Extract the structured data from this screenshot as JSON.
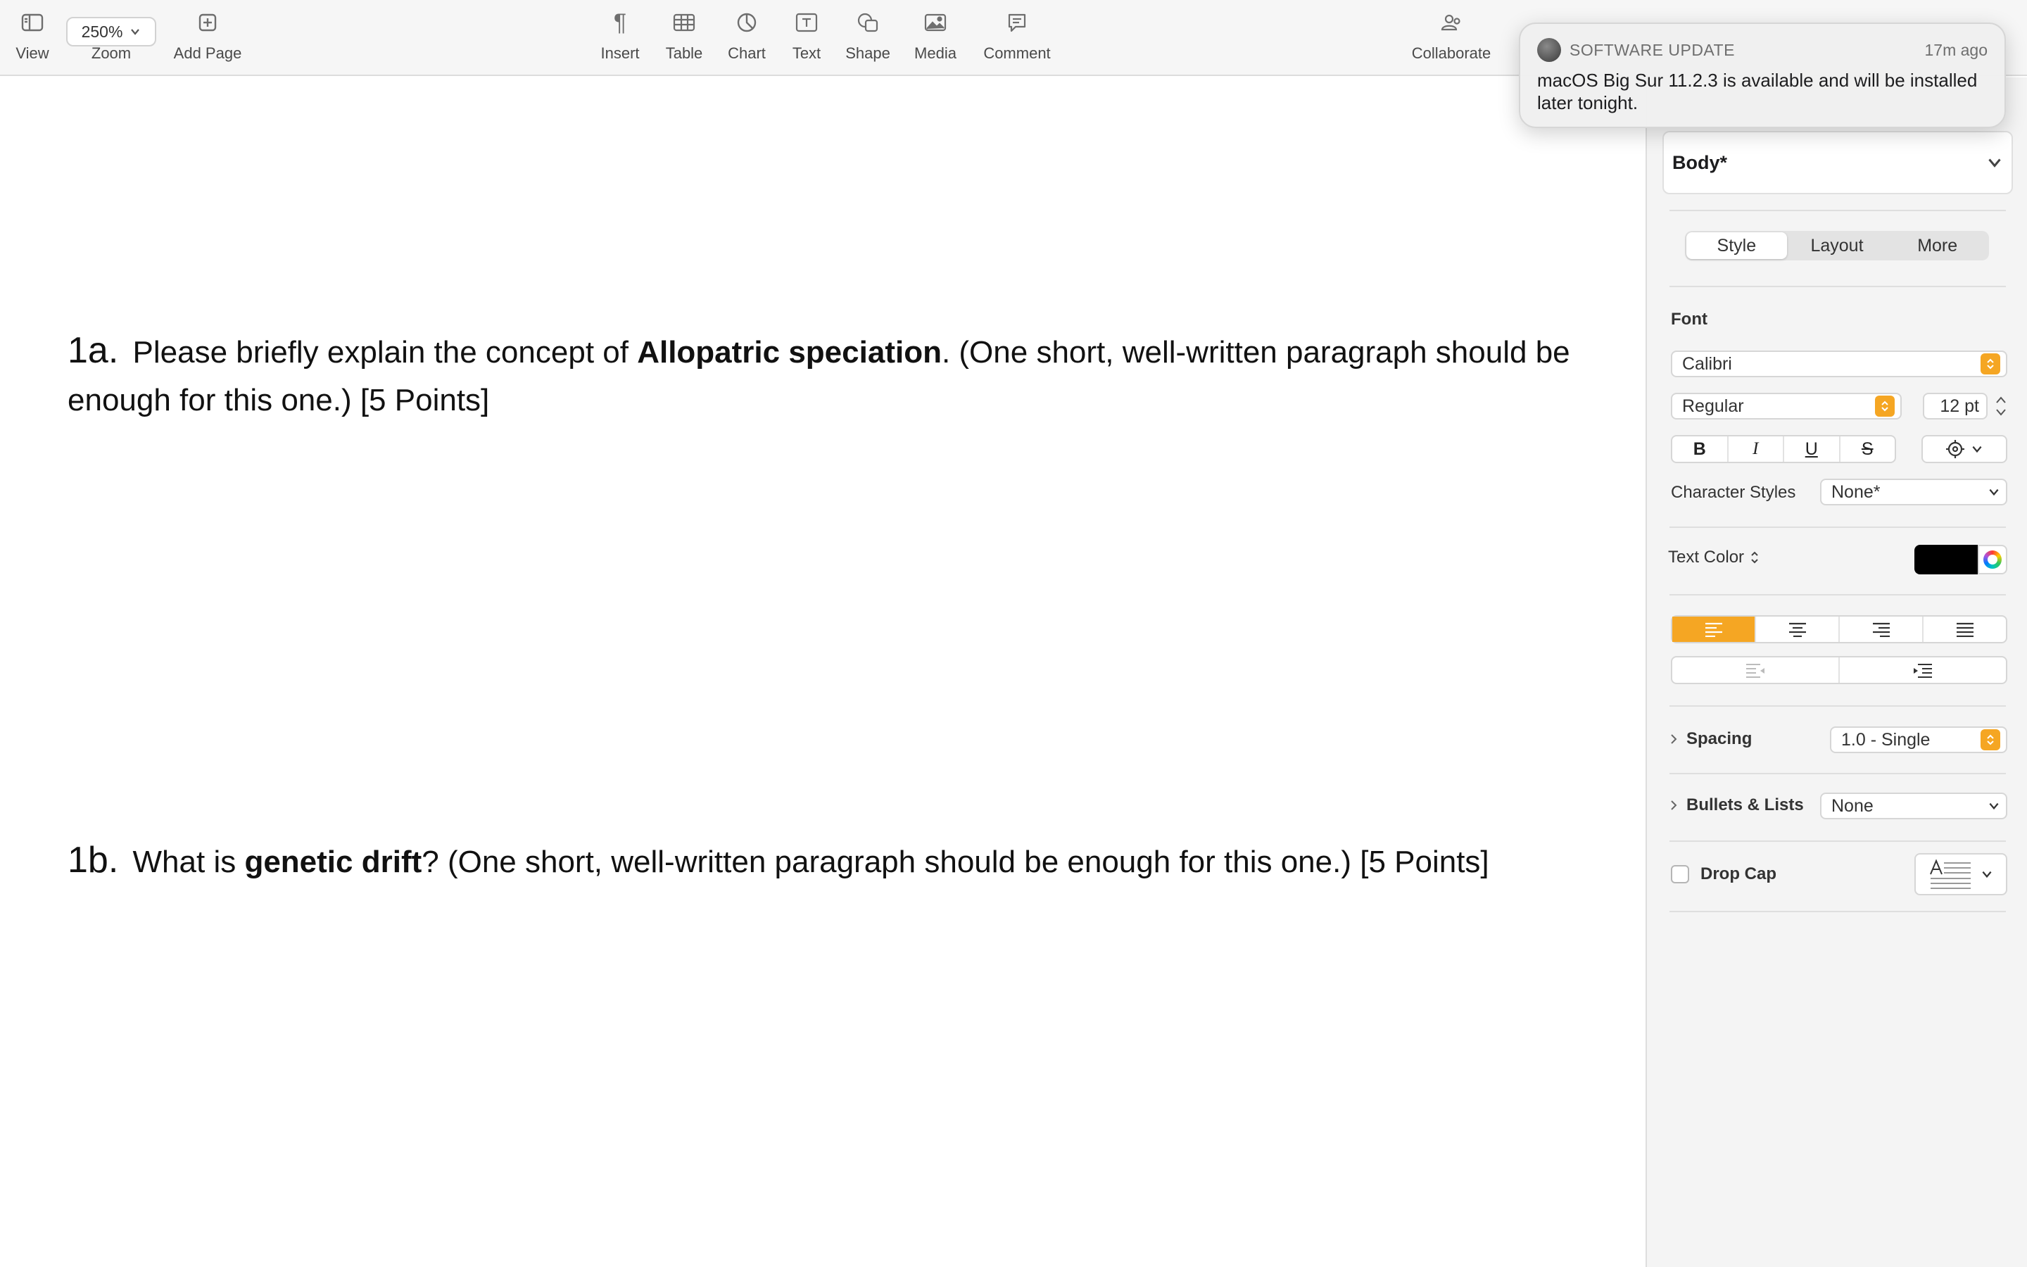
{
  "toolbar": {
    "view_label": "View",
    "zoom_value": "250%",
    "zoom_label": "Zoom",
    "add_page_label": "Add Page",
    "insert_label": "Insert",
    "table_label": "Table",
    "chart_label": "Chart",
    "text_label": "Text",
    "shape_label": "Shape",
    "media_label": "Media",
    "comment_label": "Comment",
    "collaborate_label": "Collaborate"
  },
  "notification": {
    "app": "SOFTWARE UPDATE",
    "time": "17m ago",
    "body": "macOS Big Sur 11.2.3 is available and will be installed later tonight."
  },
  "document": {
    "q1a": {
      "num": "1a.",
      "pre": "Please briefly explain the concept of ",
      "bold": "Allopatric speciation",
      "post": ". (One short, well-written paragraph should be enough for this one.) [5 Points]"
    },
    "q1b": {
      "num": "1b.",
      "pre": "What is ",
      "bold": "genetic drift",
      "post": "? (One short, well-written paragraph should be enough for this one.) [5 Points]"
    }
  },
  "sidebar": {
    "paragraph_style": "Body*",
    "tabs": {
      "style": "Style",
      "layout": "Layout",
      "more": "More"
    },
    "font_heading": "Font",
    "font_family": "Calibri",
    "font_weight": "Regular",
    "font_size": "12 pt",
    "format_buttons": {
      "bold": "B",
      "italic": "I",
      "underline": "U",
      "strike": "S"
    },
    "character_styles_label": "Character Styles",
    "character_styles_value": "None*",
    "text_color_label": "Text Color",
    "text_color": "#000000",
    "spacing_label": "Spacing",
    "spacing_value": "1.0 - Single",
    "bullets_label": "Bullets & Lists",
    "bullets_value": "None",
    "drop_cap_label": "Drop Cap",
    "accent_color": "#f5a623"
  }
}
